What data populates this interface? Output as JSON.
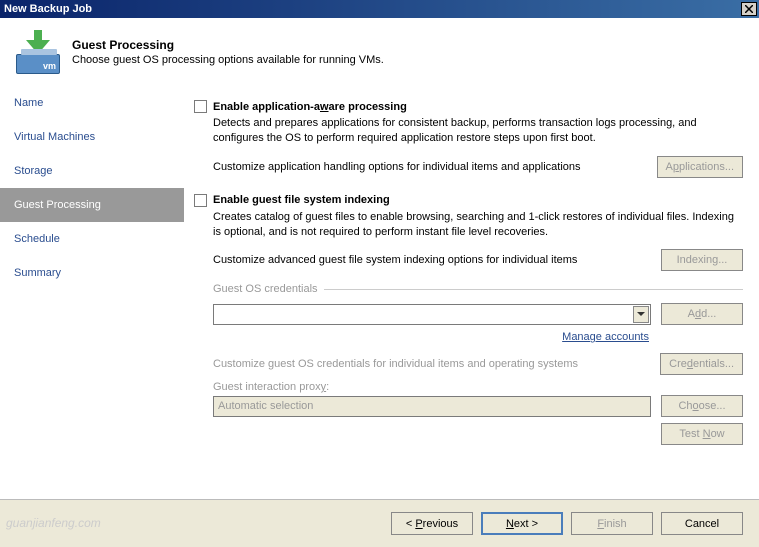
{
  "titlebar": {
    "title": "New Backup Job"
  },
  "header": {
    "title": "Guest Processing",
    "subtitle": "Choose guest OS processing options available for running VMs.",
    "vm_text": "vm"
  },
  "sidebar": {
    "items": [
      {
        "label": "Name"
      },
      {
        "label": "Virtual Machines"
      },
      {
        "label": "Storage"
      },
      {
        "label": "Guest Processing"
      },
      {
        "label": "Schedule"
      },
      {
        "label": "Summary"
      }
    ]
  },
  "main": {
    "app_aware": {
      "label_pre": "Enable application-a",
      "label_u": "w",
      "label_post": "are processing",
      "desc": "Detects and prepares applications for consistent backup, performs transaction logs processing, and configures the OS to perform required application restore steps upon first boot.",
      "opt_text": "Customize application handling options for individual items and applications",
      "button_pre": "A",
      "button_u": "p",
      "button_post": "plications..."
    },
    "indexing": {
      "label": "Enable guest file system indexing",
      "desc": "Creates catalog of guest files to enable browsing, searching and 1-click restores of individual files. Indexing is optional, and is not required to perform instant file level recoveries.",
      "opt_text": "Customize advanced guest file system indexing options for individual items",
      "button": "Indexing..."
    },
    "creds": {
      "legend": "Guest OS credentials",
      "add_pre": "A",
      "add_u": "d",
      "add_post": "d...",
      "manage": "Manage accounts",
      "customize_text": "Customize guest OS credentials for individual items and operating systems",
      "cred_button_pre": "Cre",
      "cred_button_u": "d",
      "cred_button_post": "entials..."
    },
    "proxy": {
      "label_pre": "Guest interaction prox",
      "label_u": "y",
      "label_post": ":",
      "value": "Automatic selection",
      "choose_pre": "Ch",
      "choose_u": "o",
      "choose_post": "ose...",
      "test_pre": "Test ",
      "test_u": "N",
      "test_post": "ow"
    }
  },
  "footer": {
    "prev": "Previous",
    "next_pre": "",
    "next_u": "N",
    "next_post": "ext >",
    "finish_pre": "",
    "finish_u": "F",
    "finish_post": "inish",
    "cancel": "Cancel"
  },
  "watermark": "guanjianfeng.com"
}
